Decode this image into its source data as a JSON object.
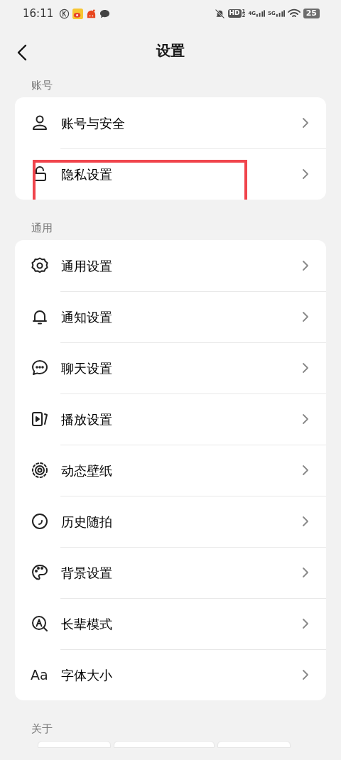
{
  "status_bar": {
    "time": "16:11",
    "hd": "HD",
    "hd_sup": "1",
    "hd_sub": "2",
    "net1": "4G",
    "net2": "5G",
    "battery": "25"
  },
  "header": {
    "title": "设置"
  },
  "sections": [
    {
      "label": "账号",
      "items": [
        {
          "label": "账号与安全",
          "highlighted": false
        },
        {
          "label": "隐私设置",
          "highlighted": true
        }
      ]
    },
    {
      "label": "通用",
      "items": [
        {
          "label": "通用设置",
          "highlighted": false
        },
        {
          "label": "通知设置",
          "highlighted": false
        },
        {
          "label": "聊天设置",
          "highlighted": false
        },
        {
          "label": "播放设置",
          "highlighted": false
        },
        {
          "label": "动态壁纸",
          "highlighted": false
        },
        {
          "label": "历史随拍",
          "highlighted": false
        },
        {
          "label": "背景设置",
          "highlighted": false
        },
        {
          "label": "长辈模式",
          "highlighted": false
        },
        {
          "label": "字体大小",
          "glyph": "Aa",
          "highlighted": false
        }
      ]
    },
    {
      "label": "关于"
    }
  ]
}
